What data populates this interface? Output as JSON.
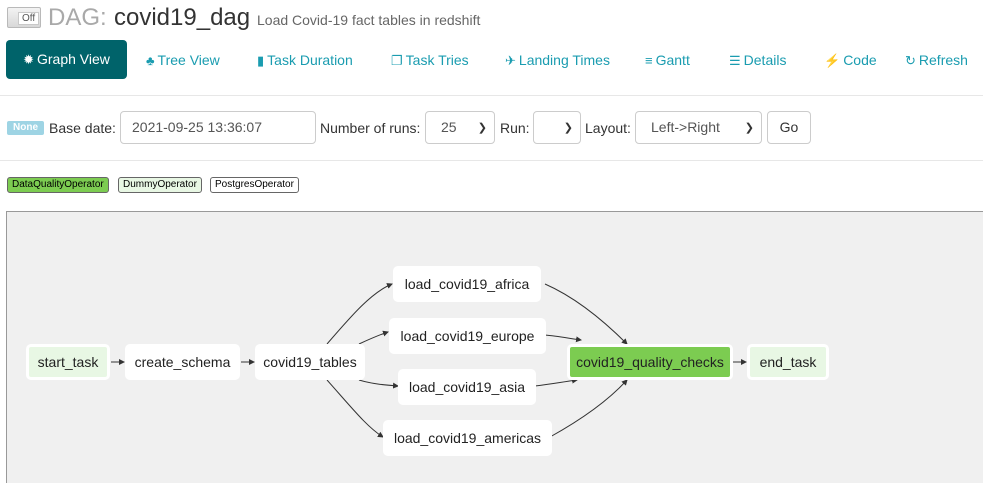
{
  "header": {
    "toggle_label": "Off",
    "dag_prefix": "DAG:",
    "dag_id": "covid19_dag",
    "description": "Load Covid-19 fact tables in redshift"
  },
  "nav": [
    {
      "label": "Graph View",
      "icon": "asterisk-icon",
      "glyph": "✹"
    },
    {
      "label": "Tree View",
      "icon": "tree-icon",
      "glyph": "♣"
    },
    {
      "label": "Task Duration",
      "icon": "bar-chart-icon",
      "glyph": "▮"
    },
    {
      "label": "Task Tries",
      "icon": "duplicate-icon",
      "glyph": "❐"
    },
    {
      "label": "Landing Times",
      "icon": "plane-icon",
      "glyph": "✈"
    },
    {
      "label": "Gantt",
      "icon": "align-left-icon",
      "glyph": "≡"
    },
    {
      "label": "Details",
      "icon": "list-icon",
      "glyph": "☰"
    },
    {
      "label": "Code",
      "icon": "flash-icon",
      "glyph": "⚡"
    },
    {
      "label": "Refresh",
      "icon": "refresh-icon",
      "glyph": "↻"
    }
  ],
  "form": {
    "status_badge": "None",
    "base_date_label": "Base date:",
    "base_date_value": "2021-09-25 13:36:07",
    "num_runs_label": "Number of runs:",
    "num_runs_value": "25",
    "run_label": "Run:",
    "run_value": "",
    "layout_label": "Layout:",
    "layout_value": "Left->Right",
    "go_label": "Go"
  },
  "legend": [
    {
      "label": "DataQualityOperator",
      "color": "#7ccc51"
    },
    {
      "label": "DummyOperator",
      "color": "#e8f7e4"
    },
    {
      "label": "PostgresOperator",
      "color": "#ffffff"
    }
  ],
  "graph": {
    "nodes": {
      "start_task": "start_task",
      "create_schema": "create_schema",
      "covid19_tables": "covid19_tables",
      "load_covid19_africa": "load_covid19_africa",
      "load_covid19_europe": "load_covid19_europe",
      "load_covid19_asia": "load_covid19_asia",
      "load_covid19_americas": "load_covid19_americas",
      "covid19_quality_checks": "covid19_quality_checks",
      "end_task": "end_task"
    },
    "edges": [
      [
        "start_task",
        "create_schema"
      ],
      [
        "create_schema",
        "covid19_tables"
      ],
      [
        "covid19_tables",
        "load_covid19_africa"
      ],
      [
        "covid19_tables",
        "load_covid19_europe"
      ],
      [
        "covid19_tables",
        "load_covid19_asia"
      ],
      [
        "covid19_tables",
        "load_covid19_americas"
      ],
      [
        "load_covid19_africa",
        "covid19_quality_checks"
      ],
      [
        "load_covid19_europe",
        "covid19_quality_checks"
      ],
      [
        "load_covid19_asia",
        "covid19_quality_checks"
      ],
      [
        "load_covid19_americas",
        "covid19_quality_checks"
      ],
      [
        "covid19_quality_checks",
        "end_task"
      ]
    ]
  }
}
